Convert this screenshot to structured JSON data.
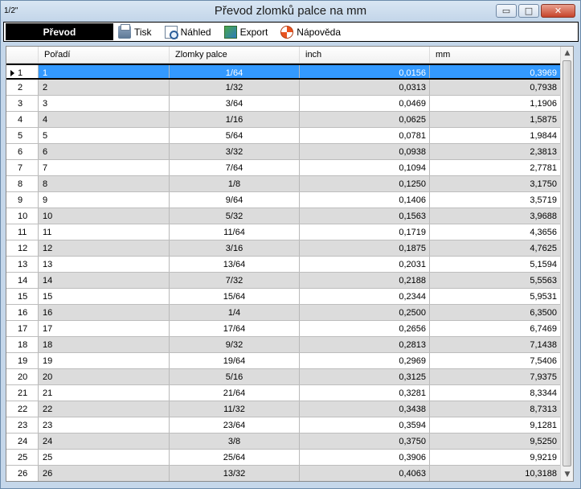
{
  "window": {
    "icon_text": "1/2\"",
    "title": "Převod zlomků palce na mm",
    "minimize_glyph": "▭",
    "maximize_glyph": "□",
    "close_glyph": "✕"
  },
  "toolbar": {
    "active_label": "Převod",
    "items": [
      {
        "label": "Tisk",
        "icon": "printer-icon"
      },
      {
        "label": "Náhled",
        "icon": "preview-icon"
      },
      {
        "label": "Export",
        "icon": "export-icon"
      },
      {
        "label": "Nápověda",
        "icon": "help-icon"
      }
    ]
  },
  "grid": {
    "columns": [
      "Pořadí",
      "Zlomky palce",
      "inch",
      "mm"
    ],
    "selected_row": 1,
    "rows": [
      {
        "n": "1",
        "poradi": "1",
        "zlomek": "1/64",
        "inch": "0,0156",
        "mm": "0,3969"
      },
      {
        "n": "2",
        "poradi": "2",
        "zlomek": "1/32",
        "inch": "0,0313",
        "mm": "0,7938"
      },
      {
        "n": "3",
        "poradi": "3",
        "zlomek": "3/64",
        "inch": "0,0469",
        "mm": "1,1906"
      },
      {
        "n": "4",
        "poradi": "4",
        "zlomek": "1/16",
        "inch": "0,0625",
        "mm": "1,5875"
      },
      {
        "n": "5",
        "poradi": "5",
        "zlomek": "5/64",
        "inch": "0,0781",
        "mm": "1,9844"
      },
      {
        "n": "6",
        "poradi": "6",
        "zlomek": "3/32",
        "inch": "0,0938",
        "mm": "2,3813"
      },
      {
        "n": "7",
        "poradi": "7",
        "zlomek": "7/64",
        "inch": "0,1094",
        "mm": "2,7781"
      },
      {
        "n": "8",
        "poradi": "8",
        "zlomek": "1/8",
        "inch": "0,1250",
        "mm": "3,1750"
      },
      {
        "n": "9",
        "poradi": "9",
        "zlomek": "9/64",
        "inch": "0,1406",
        "mm": "3,5719"
      },
      {
        "n": "10",
        "poradi": "10",
        "zlomek": "5/32",
        "inch": "0,1563",
        "mm": "3,9688"
      },
      {
        "n": "11",
        "poradi": "11",
        "zlomek": "11/64",
        "inch": "0,1719",
        "mm": "4,3656"
      },
      {
        "n": "12",
        "poradi": "12",
        "zlomek": "3/16",
        "inch": "0,1875",
        "mm": "4,7625"
      },
      {
        "n": "13",
        "poradi": "13",
        "zlomek": "13/64",
        "inch": "0,2031",
        "mm": "5,1594"
      },
      {
        "n": "14",
        "poradi": "14",
        "zlomek": "7/32",
        "inch": "0,2188",
        "mm": "5,5563"
      },
      {
        "n": "15",
        "poradi": "15",
        "zlomek": "15/64",
        "inch": "0,2344",
        "mm": "5,9531"
      },
      {
        "n": "16",
        "poradi": "16",
        "zlomek": "1/4",
        "inch": "0,2500",
        "mm": "6,3500"
      },
      {
        "n": "17",
        "poradi": "17",
        "zlomek": "17/64",
        "inch": "0,2656",
        "mm": "6,7469"
      },
      {
        "n": "18",
        "poradi": "18",
        "zlomek": "9/32",
        "inch": "0,2813",
        "mm": "7,1438"
      },
      {
        "n": "19",
        "poradi": "19",
        "zlomek": "19/64",
        "inch": "0,2969",
        "mm": "7,5406"
      },
      {
        "n": "20",
        "poradi": "20",
        "zlomek": "5/16",
        "inch": "0,3125",
        "mm": "7,9375"
      },
      {
        "n": "21",
        "poradi": "21",
        "zlomek": "21/64",
        "inch": "0,3281",
        "mm": "8,3344"
      },
      {
        "n": "22",
        "poradi": "22",
        "zlomek": "11/32",
        "inch": "0,3438",
        "mm": "8,7313"
      },
      {
        "n": "23",
        "poradi": "23",
        "zlomek": "23/64",
        "inch": "0,3594",
        "mm": "9,1281"
      },
      {
        "n": "24",
        "poradi": "24",
        "zlomek": "3/8",
        "inch": "0,3750",
        "mm": "9,5250"
      },
      {
        "n": "25",
        "poradi": "25",
        "zlomek": "25/64",
        "inch": "0,3906",
        "mm": "9,9219"
      },
      {
        "n": "26",
        "poradi": "26",
        "zlomek": "13/32",
        "inch": "0,4063",
        "mm": "10,3188"
      }
    ]
  },
  "colors": {
    "selection": "#3399ff",
    "alt_row": "#dcdcdc",
    "active_tab": "#000000"
  }
}
